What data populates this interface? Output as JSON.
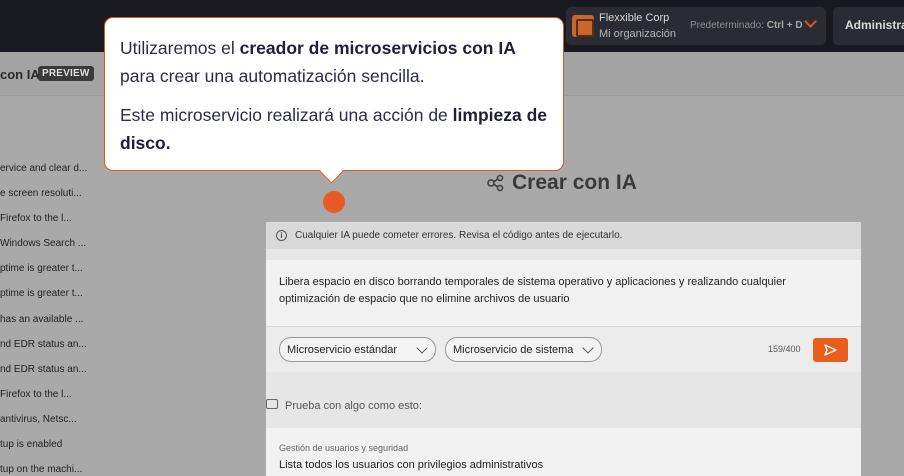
{
  "topbar": {
    "org_name": "Flexxible Corp",
    "org_sub": "Mi organización",
    "default_label": "Predeterminado:",
    "default_shortcut": "Ctrl + D",
    "admin_label": "Administra"
  },
  "subheader": {
    "title": "con IA",
    "badge": "PREVIEW"
  },
  "list": {
    "items": [
      "ervice and clear d...",
      "e screen resoluti...",
      "Firefox to the l...",
      "Windows Search ...",
      "ptime is greater t...",
      "ptime is greater t...",
      "has an available ...",
      "nd EDR status an...",
      "nd EDR status an...",
      "Firefox to the l...",
      "antivirus, Netsc...",
      "tup is enabled",
      "tup on the machi..."
    ]
  },
  "main": {
    "title": "Crear con IA",
    "warning": "Cualquier IA puede cometer errores. Revisa el código antes de ejecutarlo.",
    "prompt": "Libera espacio en disco borrando temporales de sistema operativo y aplicaciones y realizando cualquier optimización de espacio que no elimine archivos de usuario",
    "select_type": "Microservicio estándar",
    "select_scope": "Microservicio de sistema",
    "counter": "159/400",
    "try_label": "Prueba con algo como esto:",
    "suggestion_category": "Gestión de usuarios y seguridad",
    "suggestion_text": "Lista todos los usuarios con privilegios administrativos"
  },
  "tooltip": {
    "p1_a": "Utilizaremos el ",
    "p1_b": "creador de microservicios con IA",
    "p1_c": " para crear una automatización sencilla.",
    "p2_a": "Este microservicio realizará una acción de ",
    "p2_b": "limpieza de disco."
  },
  "colors": {
    "accent": "#e85e1c",
    "topbar": "#191a1f",
    "overlay": "#a9a9a9"
  }
}
